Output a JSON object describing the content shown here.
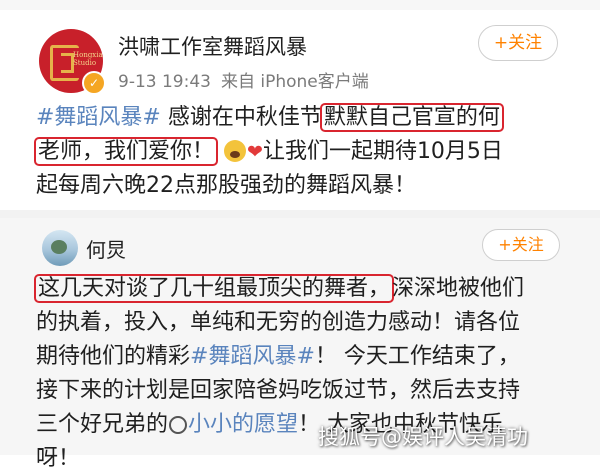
{
  "post": {
    "author_name": "洪啸工作室舞蹈风暴",
    "avatar_brand_text": "Hongxiao\nStudio",
    "timestamp": "9-13 19:43",
    "source": "来自 iPhone客户端",
    "follow_label": "+关注",
    "lines": [
      {
        "tag": "#舞蹈风暴#",
        "text": " 感谢在中秋佳节",
        "highlight": "默默自己官宣的何"
      },
      {
        "highlight": "老师，我们爱你！",
        "after": "让我们一起期待10月5日"
      },
      {
        "text": "起每周六晚22点那股强劲的舞蹈风暴！"
      }
    ]
  },
  "repost": {
    "author_name": "何炅",
    "follow_label": "+关注",
    "lines": [
      {
        "highlight": "这几天对谈了几十组最顶尖的舞者，",
        "text": "深深地被他们"
      },
      {
        "text": "的执着，投入，单纯和无穷的创造力感动！请各位"
      },
      {
        "text": "期待他们的精彩",
        "tag": "#舞蹈风暴#",
        "after": "！ 今天工作结束了，"
      },
      {
        "text": "接下来的计划是回家陪爸妈吃饭过节，然后去支持"
      },
      {
        "text": "三个好兄弟的",
        "link": "小小的愿望",
        "after": "！ 大家也中秋节快乐"
      },
      {
        "text": "呀！"
      }
    ]
  },
  "watermark": "搜狐号@娱评人吴清功",
  "icons": {
    "verified": "verified-badge-icon",
    "emoji": "scream-emoji-icon",
    "heart": "red-heart-icon",
    "film": "film-reel-icon"
  },
  "colors": {
    "topic_link": "#5a84bd",
    "highlight_box": "#d9252f",
    "follow": "#ff8200"
  }
}
